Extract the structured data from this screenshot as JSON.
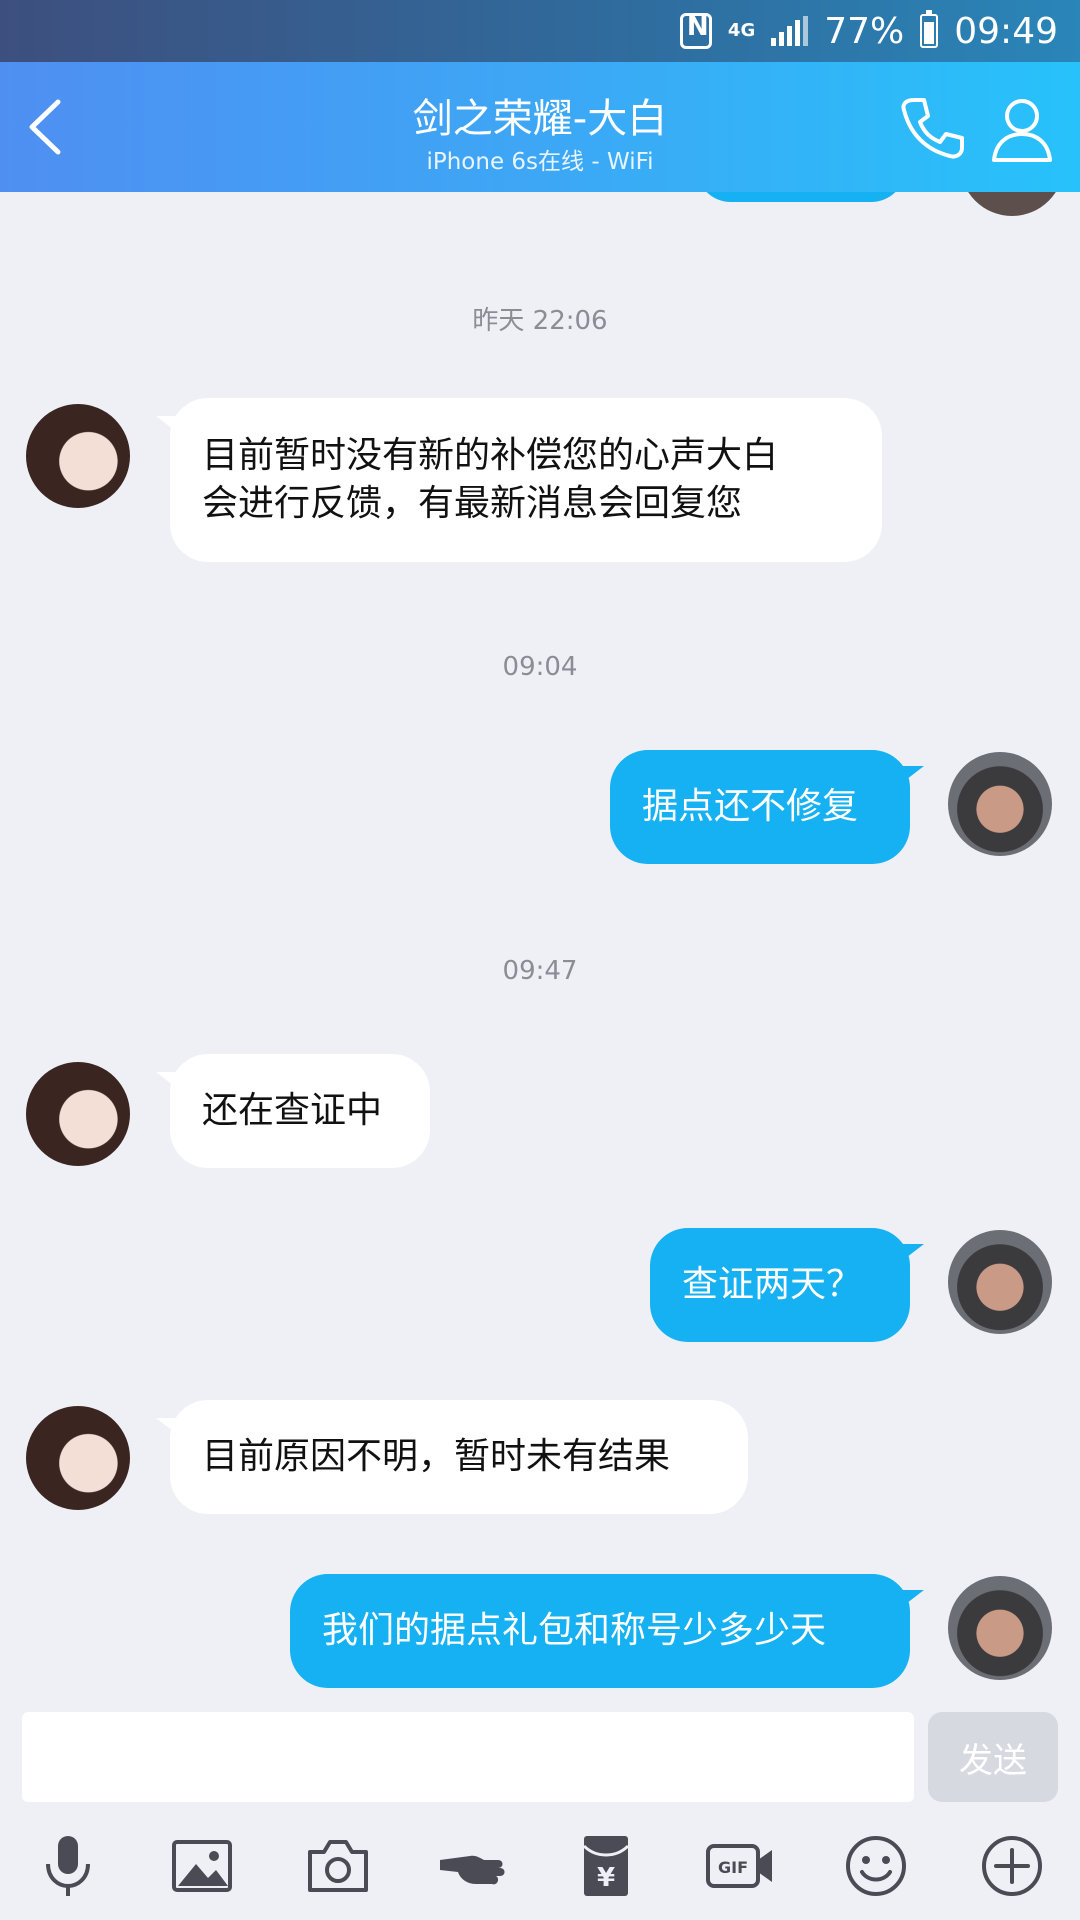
{
  "status_bar": {
    "network": "4G",
    "battery": "77%",
    "time": "09:49"
  },
  "header": {
    "title": "剑之荣耀-大白",
    "subtitle": "iPhone 6s在线 - WiFi"
  },
  "messages": [
    {
      "type": "timestamp",
      "text": "昨天 22:06"
    },
    {
      "type": "incoming",
      "lines": [
        "目前暂时没有新的补偿您的心声大白",
        "会进行反馈，有最新消息会回复您"
      ]
    },
    {
      "type": "timestamp",
      "text": "09:04"
    },
    {
      "type": "outgoing",
      "text": "据点还不修复"
    },
    {
      "type": "timestamp",
      "text": "09:47"
    },
    {
      "type": "incoming",
      "text": "还在查证中"
    },
    {
      "type": "outgoing",
      "text": "查证两天？"
    },
    {
      "type": "incoming",
      "text": "目前原因不明，暂时未有结果"
    },
    {
      "type": "outgoing",
      "text": "我们的据点礼包和称号少多少天"
    }
  ],
  "input": {
    "value": "",
    "send_label": "发送"
  },
  "toolbar": [
    "microphone-icon",
    "image-icon",
    "camera-icon",
    "pointing-hand-icon",
    "red-packet-icon",
    "gif-icon",
    "emoji-icon",
    "add-icon"
  ],
  "colors": {
    "header_start": "#4f8ff2",
    "header_end": "#27c2fb",
    "outgoing_bubble": "#16b1f2",
    "incoming_bubble": "#ffffff",
    "background": "#eef0f6"
  }
}
